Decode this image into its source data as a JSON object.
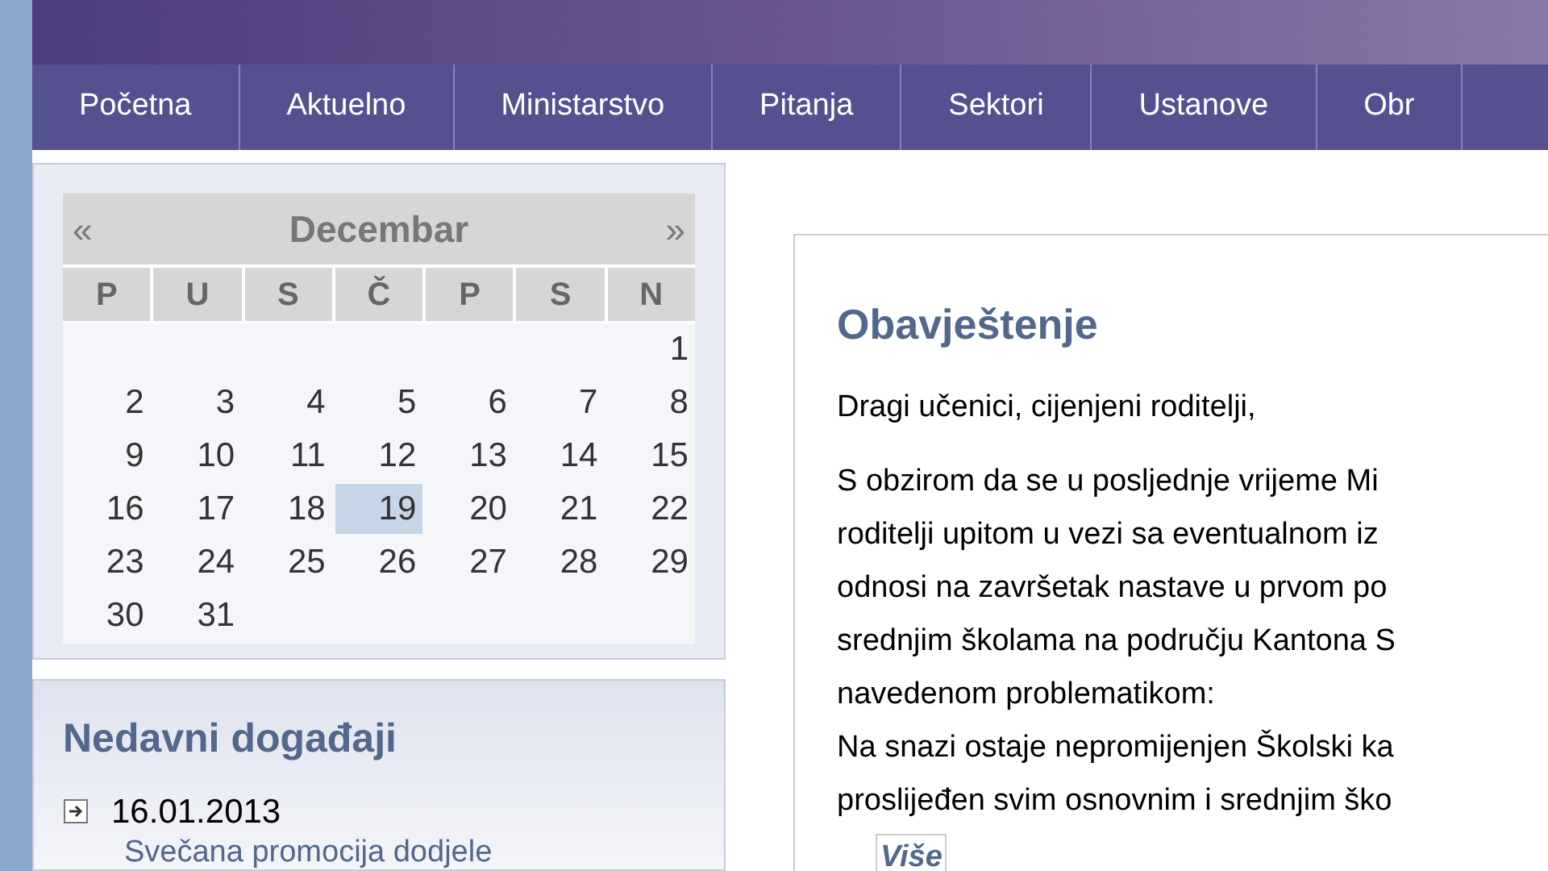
{
  "nav": [
    {
      "label": "Početna"
    },
    {
      "label": "Aktuelno"
    },
    {
      "label": "Ministarstvo"
    },
    {
      "label": "Pitanja"
    },
    {
      "label": "Sektori"
    },
    {
      "label": "Ustanove"
    },
    {
      "label": "Obr"
    }
  ],
  "calendar": {
    "prev": "«",
    "month": "Decembar",
    "next": "»",
    "weekdays": [
      "P",
      "U",
      "S",
      "Č",
      "P",
      "S",
      "N"
    ],
    "weeks": [
      {
        "kind": "first",
        "days": [
          {
            "day": "1",
            "selected": false
          }
        ]
      },
      {
        "kind": "full",
        "days": [
          {
            "day": "2",
            "selected": false
          },
          {
            "day": "3",
            "selected": false
          },
          {
            "day": "4",
            "selected": false
          },
          {
            "day": "5",
            "selected": false
          },
          {
            "day": "6",
            "selected": false
          },
          {
            "day": "7",
            "selected": false
          },
          {
            "day": "8",
            "selected": false
          }
        ]
      },
      {
        "kind": "full",
        "days": [
          {
            "day": "9",
            "selected": false
          },
          {
            "day": "10",
            "selected": false
          },
          {
            "day": "11",
            "selected": false
          },
          {
            "day": "12",
            "selected": false
          },
          {
            "day": "13",
            "selected": false
          },
          {
            "day": "14",
            "selected": false
          },
          {
            "day": "15",
            "selected": false
          }
        ]
      },
      {
        "kind": "full",
        "days": [
          {
            "day": "16",
            "selected": false
          },
          {
            "day": "17",
            "selected": false
          },
          {
            "day": "18",
            "selected": false
          },
          {
            "day": "19",
            "selected": true
          },
          {
            "day": "20",
            "selected": false
          },
          {
            "day": "21",
            "selected": false
          },
          {
            "day": "22",
            "selected": false
          }
        ]
      },
      {
        "kind": "full",
        "days": [
          {
            "day": "23",
            "selected": false
          },
          {
            "day": "24",
            "selected": false
          },
          {
            "day": "25",
            "selected": false
          },
          {
            "day": "26",
            "selected": false
          },
          {
            "day": "27",
            "selected": false
          },
          {
            "day": "28",
            "selected": false
          },
          {
            "day": "29",
            "selected": false
          }
        ]
      },
      {
        "kind": "last",
        "days": [
          {
            "day": "30",
            "selected": false
          },
          {
            "day": "31",
            "selected": false
          }
        ]
      }
    ]
  },
  "recent_events": {
    "title": "Nedavni događaji",
    "items": [
      {
        "date": "16.01.2013",
        "link": "Svečana promocija dodjele"
      }
    ]
  },
  "notice": {
    "title": "Obavještenje",
    "greeting": "Dragi učenici, cijenjeni roditelji,",
    "lines": [
      "S obzirom da se u posljednje vrijeme Mi",
      "roditelji upitom u vezi sa eventualnom iz",
      "odnosi na završetak nastave u prvom po",
      "srednjim školama na području Kantona S",
      "navedenom problematikom:",
      "Na snazi ostaje nepromijenjen Školski ka",
      "proslijeđen svim osnovnim i srednjim ško"
    ],
    "more": "Više"
  }
}
